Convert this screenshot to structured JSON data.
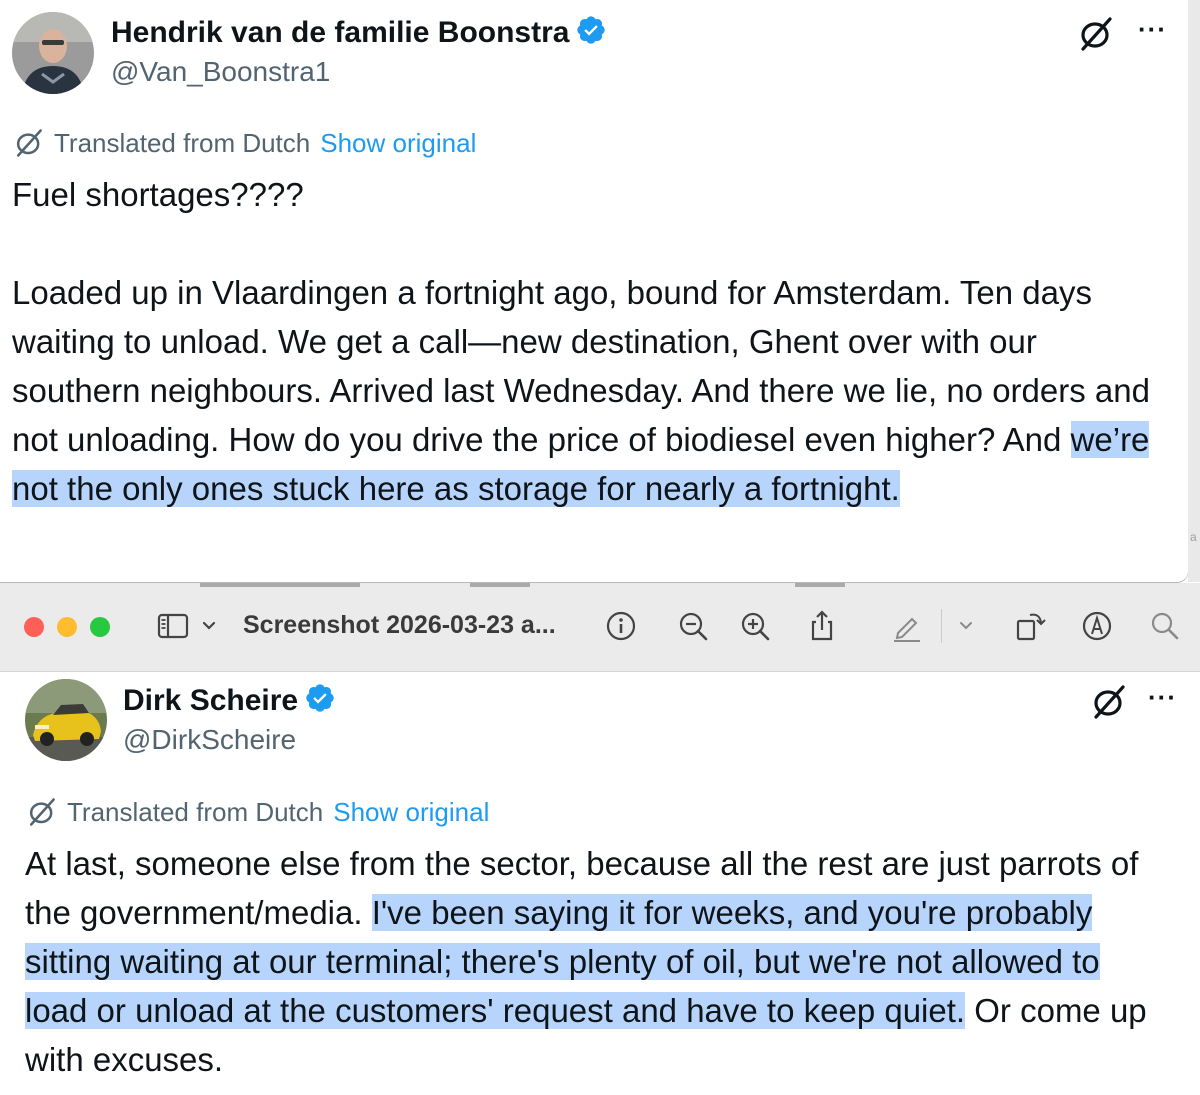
{
  "tweet1": {
    "display_name": "Hendrik van de familie Boonstra",
    "handle": "@Van_Boonstra1",
    "translated_label": "Translated from Dutch",
    "show_original_label": "Show original",
    "more_label": "···",
    "text_pre": "Fuel shortages????",
    "text_body": "Loaded up in Vlaardingen a fortnight ago, bound for Amsterdam. Ten days waiting to unload. We get a call—new destination, Ghent over with our southern neighbours. Arrived last Wednesday. And there we lie, no orders and not unloading. How do you drive the price of biodiesel even higher? And ",
    "text_highlight": "we’re not the only ones stuck here as storage for nearly a fortnight."
  },
  "toolbar": {
    "window_title": "Screenshot 2026-03-23 a...",
    "sidebar_chevron": "⌄",
    "markup_chevron": "⌄"
  },
  "tweet2": {
    "display_name": "Dirk Scheire",
    "handle": "@DirkScheire",
    "translated_label": "Translated from Dutch",
    "show_original_label": "Show original",
    "more_label": "···",
    "text_pre": "At last, someone else from the sector, because all the rest are just parrots of the government/media. ",
    "text_highlight": "I've been saying it for weeks, and you're probably sitting waiting at our terminal; there's plenty of oil, but we're not allowed to load or unload at the customers' request and have to keep quiet.",
    "text_post": " Or come up with excuses."
  },
  "colors": {
    "link": "#1d9bf0",
    "verified": "#1d9bf0",
    "highlight": "#b7d5fc",
    "traffic_red": "#fe5f57",
    "traffic_yellow": "#febc2e",
    "traffic_green": "#28c840"
  },
  "icons": [
    "verified-badge-icon",
    "grok-icon",
    "more-icon",
    "translate-icon",
    "sidebar-toggle-icon",
    "info-icon",
    "zoom-out-icon",
    "zoom-in-icon",
    "share-icon",
    "markup-pen-icon",
    "rotate-icon",
    "markup-circle-icon",
    "search-icon"
  ]
}
